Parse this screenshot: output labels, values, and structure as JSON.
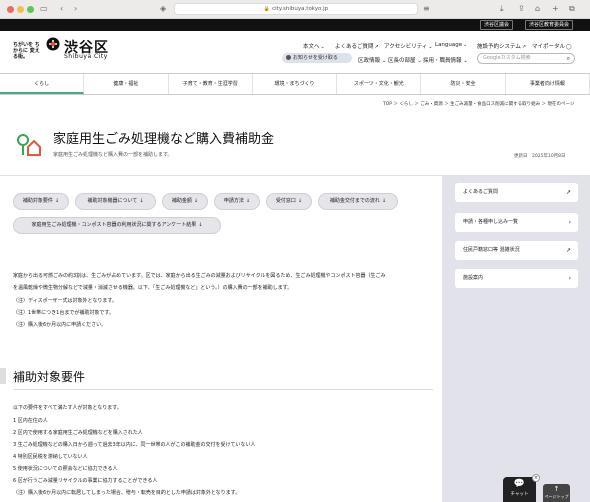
{
  "browser": {
    "url": "city.shibuya.tokyo.jp"
  },
  "topbar": {
    "links": [
      "渋谷区議会",
      "渋谷区教育委員会"
    ]
  },
  "header": {
    "tagline": "ちがいを ちからに 変える街。",
    "logo_ja": "渋谷区",
    "logo_en": "Shibuya City",
    "util_links": [
      "本文へ",
      "よくあるご質問",
      "アクセシビリティ",
      "Language",
      "施設予約システム",
      "マイポータル"
    ],
    "notice_label": "お知らせを受け取る",
    "util2_links": [
      "区政情報",
      "区長の部屋",
      "採用・職員情報"
    ],
    "search_placeholder": "Googleカスタム検索"
  },
  "nav": {
    "items": [
      "くらし",
      "健康・福祉",
      "子育て・教育・生涯学習",
      "環境・まちづくり",
      "スポーツ・文化・観光",
      "防災・安全",
      "事業者向け情報"
    ]
  },
  "breadcrumb": "TOP ＞ くらし ＞ ごみ・資源 ＞ 生ごみ減量・食品ロス削減に関する取り組み ＞ 現在のページ",
  "page": {
    "title": "家庭用生ごみ処理機など購入費補助金",
    "subtitle": "家庭用生ごみ処理機など購入費の一部を補助します。",
    "updated": "更新日　2025年10月8日"
  },
  "anchors": [
    {
      "label": "補助対象要件"
    },
    {
      "label": "補助対象機器について"
    },
    {
      "label": "補助金額"
    },
    {
      "label": "申請方法"
    },
    {
      "label": "受付窓口"
    },
    {
      "label": "補助金交付までの流れ"
    },
    {
      "label": "家庭用生ごみ処理機・コンポスト容器の利用状況に関するアンケート結果"
    }
  ],
  "intro": [
    "家庭から出る可燃ごみの約3割は、生ごみが占めています。区では、家庭から出る生ごみの減量およびリサイクルを図るため、生ごみ処理機やコンポスト容器（生ごみ",
    "を温風乾燥や微生物分解などで減量・消滅させる機器。以下、「生ごみ処理機など」という。）の購入費の一部を補助します。",
    "（注）ディスポーザー式は対象外となります。",
    "（注）1世帯につき1台までが補助対象です。",
    "（注）購入後6か月以内に申請ください。"
  ],
  "section": {
    "heading": "補助対象要件",
    "lead": "以下の要件をすべて満たす人が対象となります。",
    "items": [
      "1 区内在住の人",
      "2 区内で使用する家庭用生ごみ処理機などを購入された人",
      "3 生ごみ処理機などの購入日から遡って過去3年以内に、同一世帯の人がこの補助金の交付を受けていない人",
      "4 特別区民税を滞納していない人",
      "5 使用状況についての照会などに協力できる人",
      "6 区が行うごみ減量リサイクルの事業に協力することができる人",
      "（注）購入後6か月以内に転居してしまった場合、贈与・転売を目的とした申請は対象外となります。"
    ]
  },
  "side": {
    "cards": [
      {
        "label": "よくあるご質問",
        "icon": "external-icon"
      },
      {
        "label": "申請・各種申し込み一覧",
        "icon": "chevron-right-icon"
      },
      {
        "label": "住民戸籍窓口等 混雑状況",
        "icon": "external-icon"
      },
      {
        "label": "施設案内",
        "icon": "chevron-right-icon"
      }
    ]
  },
  "floating": {
    "chat_label": "チャット",
    "close_label": "×",
    "top_label": "ページトップ"
  }
}
